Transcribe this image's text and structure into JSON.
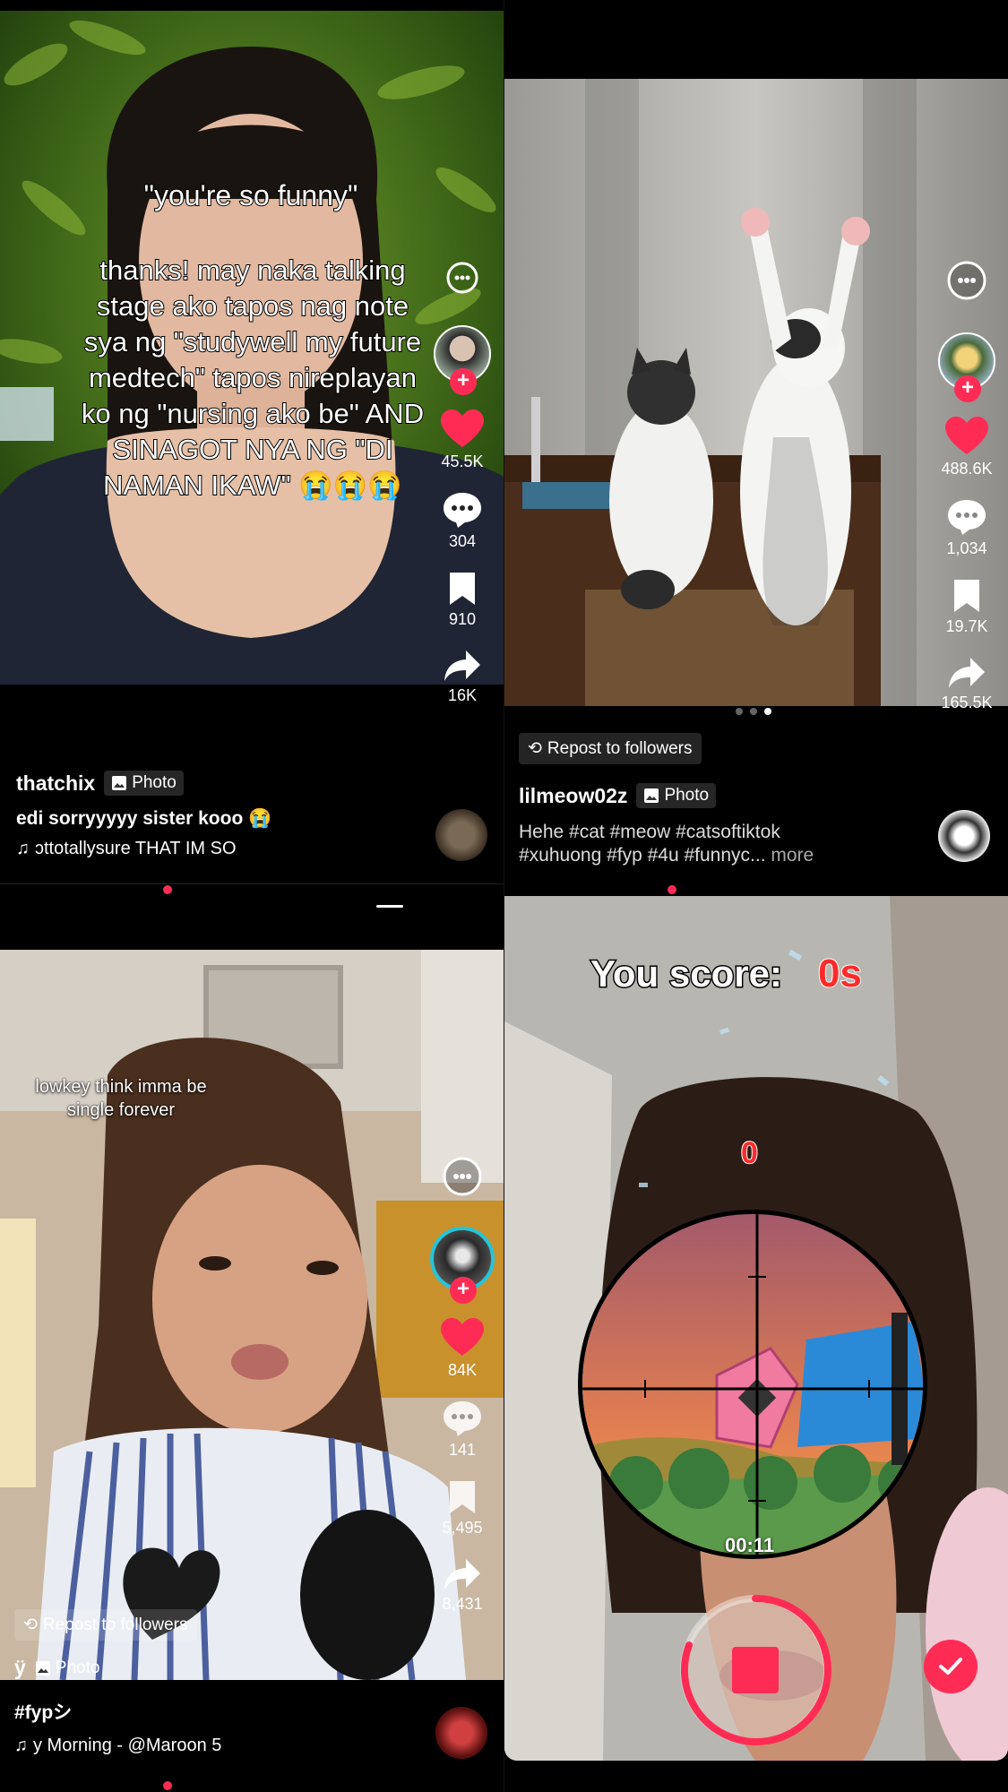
{
  "colors": {
    "accent": "#fe2c55",
    "background": "#000000"
  },
  "post1": {
    "text_headline": "\"you're so funny\"",
    "text_body": "thanks! may naka talking stage ako tapos nag note sya ng \"studywell my future medtech\" tapos nireplayan ko ng \"nursing ako be\" AND SINAGOT NYA NG \"DI NAMAN IKAW\" 😭😭😭",
    "likes": "45.5K",
    "comments": "304",
    "saves": "910",
    "shares": "16K",
    "username": "thatchix",
    "type_tag": "Photo",
    "caption": "edi sorryyyyy sister kooo 😭",
    "music": "ɔttotallysure    THAT IM SO"
  },
  "post2": {
    "likes": "488.6K",
    "comments": "1,034",
    "saves": "19.7K",
    "shares": "165.5K",
    "repost_label": "Repost to followers",
    "username": "lilmeow02z",
    "type_tag": "Photo",
    "caption_line1": "Hehe #cat #meow #catsoftiktok",
    "caption_line2": "#xuhuong #fyp #4u #funnyc...",
    "more_label": "more",
    "carousel_active": 3,
    "carousel_total": 3
  },
  "post3": {
    "overlay_text": "lowkey think imma be single forever",
    "likes": "84K",
    "comments": "141",
    "saves": "5,495",
    "shares": "8,431",
    "repost_label": "Repost to followers",
    "username": "ÿ",
    "type_tag": "Photo",
    "caption": "#fypシ",
    "music": "y Morning - @Maroon 5"
  },
  "post4": {
    "score_label": "You score:",
    "score_value": "0s",
    "hit_count": "0",
    "timer": "00:11"
  },
  "icons": {
    "more": "face-dots-icon",
    "like": "heart-icon",
    "comment": "speech-bubble-icon",
    "save": "bookmark-icon",
    "share": "share-arrow-icon",
    "music": "music-note-icon",
    "repost": "repost-icon",
    "photo": "image-icon",
    "record_stop": "stop-square-icon",
    "confirm": "check-icon"
  }
}
